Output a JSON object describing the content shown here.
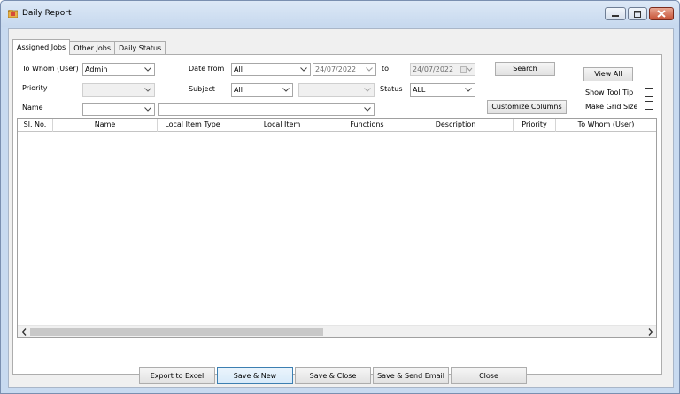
{
  "window": {
    "title": "Daily Report"
  },
  "tabs": [
    "Assigned Jobs",
    "Other Jobs",
    "Daily Status"
  ],
  "filters": {
    "to_whom_label": "To Whom (User)",
    "to_whom_value": "Admin",
    "priority_label": "Priority",
    "priority_value": "",
    "name_label": "Name",
    "name_value": "",
    "name_detail_value": "",
    "date_from_label": "Date from",
    "date_from_value": "All",
    "date_from_date": "24/07/2022",
    "to_label": "to",
    "to_date": "24/07/2022",
    "subject_label": "Subject",
    "subject_value": "All",
    "subject_detail_value": "",
    "status_label": "Status",
    "status_value": "ALL",
    "search_button": "Search",
    "customize_columns_button": "Customize Columns",
    "view_all_button": "View All",
    "show_tool_tip_label": "Show Tool Tip",
    "make_grid_size_label": "Make Grid Size"
  },
  "grid": {
    "columns": [
      "Sl. No.",
      "Name",
      "Local Item Type",
      "Local Item",
      "Functions",
      "Description",
      "Priority",
      "To Whom (User)"
    ],
    "rows": []
  },
  "buttons": {
    "export_to_excel": "Export to Excel",
    "save_new": "Save & New",
    "save_close": "Save & Close",
    "save_send_email": "Save & Send Email",
    "close": "Close"
  }
}
